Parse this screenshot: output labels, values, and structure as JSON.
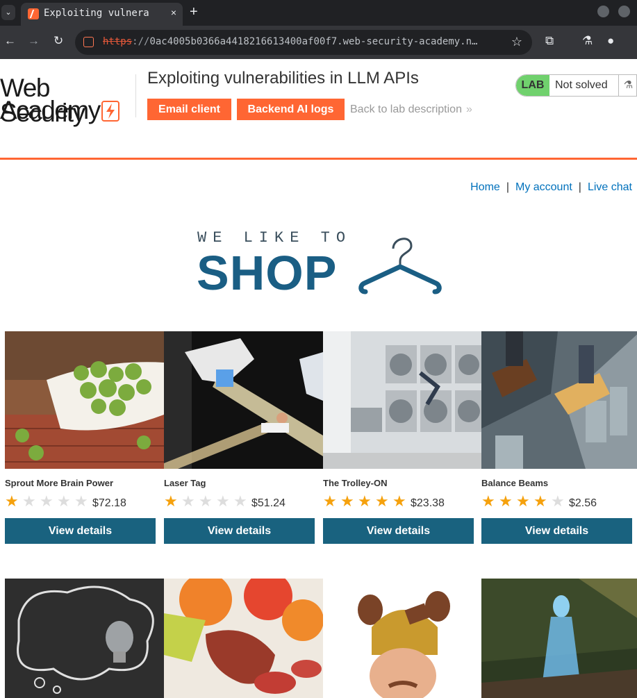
{
  "browser": {
    "tab_title": "Exploiting vulnera",
    "tab_close": "×",
    "new_tab": "+",
    "url_scheme": "https",
    "url_sep": "://",
    "url_host": "0ac4005b0366a4418216613400af00f7.web-security-academy.n…",
    "icons": [
      "tab-list-icon",
      "back-icon",
      "forward-icon",
      "reload-icon",
      "star-icon",
      "extensions-icon",
      "labs-icon",
      "profile-icon"
    ]
  },
  "lab": {
    "logo_line1": "Web Security",
    "logo_line2": "Academy",
    "title": "Exploiting vulnerabilities in LLM APIs",
    "email_client": "Email client",
    "backend_logs": "Backend AI logs",
    "back_link": "Back to lab description",
    "back_chevron": "»",
    "badge": "LAB",
    "status": "Not solved",
    "accent": "#ff6633",
    "badge_color": "#70d16d"
  },
  "nav": {
    "home": "Home",
    "sep": "|",
    "account": "My account",
    "chat": "Live chat"
  },
  "banner": {
    "small": "WE LIKE TO",
    "big": "SHOP"
  },
  "products": [
    {
      "name": "Sprout More Brain Power",
      "rating": 1,
      "price": "$72.18",
      "button": "View details",
      "image": "brussels-sprouts-photo"
    },
    {
      "name": "Laser Tag",
      "rating": 1,
      "price": "$51.24",
      "button": "View details",
      "image": "laser-tag-photo"
    },
    {
      "name": "The Trolley-ON",
      "rating": 5,
      "price": "$23.38",
      "button": "View details",
      "image": "laundromat-photo"
    },
    {
      "name": "Balance Beams",
      "rating": 4,
      "price": "$2.56",
      "button": "View details",
      "image": "skyscraper-feet-photo"
    }
  ],
  "products_row2": [
    {
      "image": "lightbulb-chalkboard-photo"
    },
    {
      "image": "food-platter-photo"
    },
    {
      "image": "poo-head-hat-photo"
    },
    {
      "image": "hologram-woman-photo"
    }
  ],
  "star_glyph": "★"
}
